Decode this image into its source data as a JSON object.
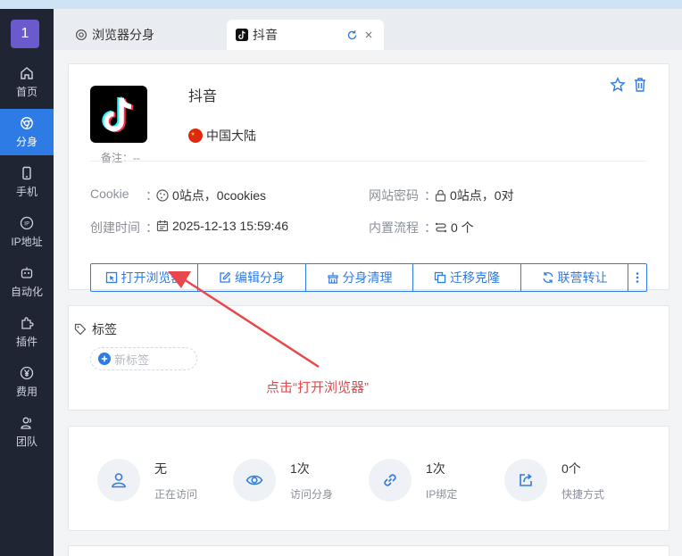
{
  "sidebar": {
    "logo": "1",
    "items": [
      {
        "label": "首页"
      },
      {
        "label": "分身"
      },
      {
        "label": "手机"
      },
      {
        "label": "IP地址"
      },
      {
        "label": "自动化"
      },
      {
        "label": "插件"
      },
      {
        "label": "费用"
      },
      {
        "label": "团队"
      }
    ]
  },
  "tabs": [
    {
      "label": "浏览器分身"
    },
    {
      "label": "抖音"
    }
  ],
  "profile": {
    "name": "抖音",
    "region": "中国大陆",
    "remark_label": "备注：--",
    "cookie_label": "Cookie",
    "cookie_value": "0站点，0cookies",
    "password_label": "网站密码",
    "password_value": "0站点，0对",
    "created_label": "创建时间",
    "created_value": "2025-12-13 15:59:46",
    "flow_label": "内置流程",
    "flow_value": "0 个",
    "colon": "："
  },
  "actions": [
    {
      "label": "打开浏览器"
    },
    {
      "label": "编辑分身"
    },
    {
      "label": "分身清理"
    },
    {
      "label": "迁移克隆"
    },
    {
      "label": "联营转让"
    }
  ],
  "tags": {
    "title": "标签",
    "new_tag": "新标签"
  },
  "annotation": "点击“打开浏览器”",
  "stats": [
    {
      "value": "无",
      "label": "正在访问"
    },
    {
      "value": "1次",
      "label": "访问分身"
    },
    {
      "value": "1次",
      "label": "IP绑定"
    },
    {
      "value": "0个",
      "label": "快捷方式"
    }
  ],
  "colors": {
    "accent": "#2f7be6",
    "sidebar": "#1f2533",
    "annotation": "#e8474c"
  }
}
